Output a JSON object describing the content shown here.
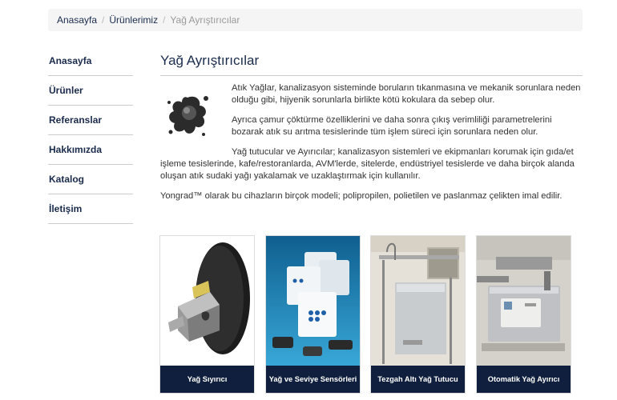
{
  "breadcrumb": {
    "items": [
      "Anasayfa",
      "Ürünlerimiz",
      "Yağ Ayrıştırıcılar"
    ],
    "separator": "/"
  },
  "sidebar": {
    "items": [
      {
        "label": "Anasayfa"
      },
      {
        "label": "Ürünler"
      },
      {
        "label": "Referanslar"
      },
      {
        "label": "Hakkımızda"
      },
      {
        "label": "Katalog"
      },
      {
        "label": "İletişim"
      }
    ]
  },
  "main": {
    "title": "Yağ Ayrıştırıcılar",
    "paragraphs": [
      "Atık Yağlar, kanalizasyon sisteminde boruların tıkanmasına ve mekanik sorunlara neden olduğu gibi, hijyenik sorunlarla birlikte kötü kokulara da sebep olur.",
      "Ayrıca çamur çöktürme özelliklerini ve daha sonra çıkış verimliliği parametrelerini bozarak atık su arıtma tesislerinde tüm işlem süreci için sorunlara neden olur.",
      "Yağ tutucular ve Ayırıcılar; kanalizasyon sistemleri ve ekipmanları korumak için gıda/et işleme tesislerinde, kafe/restoranlarda, AVM'lerde, sitelerde, endüstriyel tesislerde ve daha birçok alanda oluşan atık sudaki yağı yakalamak ve uzaklaştırmak için kullanılır.",
      "Yongrad™ olarak bu cihazların birçok modeli; polipropilen, polietilen ve paslanmaz çelikten imal edilir."
    ]
  },
  "products": [
    {
      "name": "Yağ Sıyırıcı",
      "icon": "oil-skimmer-image"
    },
    {
      "name": "Yağ ve Seviye Sensörleri",
      "icon": "oil-level-sensors-image"
    },
    {
      "name": "Tezgah Altı Yağ Tutucu",
      "icon": "undercounter-grease-trap-image"
    },
    {
      "name": "Otomatik Yağ Ayırıcı",
      "icon": "automatic-grease-separator-image"
    }
  ],
  "colors": {
    "navy": "#0f1f3d",
    "link": "#1a2b4c",
    "breadcrumb_bg": "#f5f5f5"
  }
}
